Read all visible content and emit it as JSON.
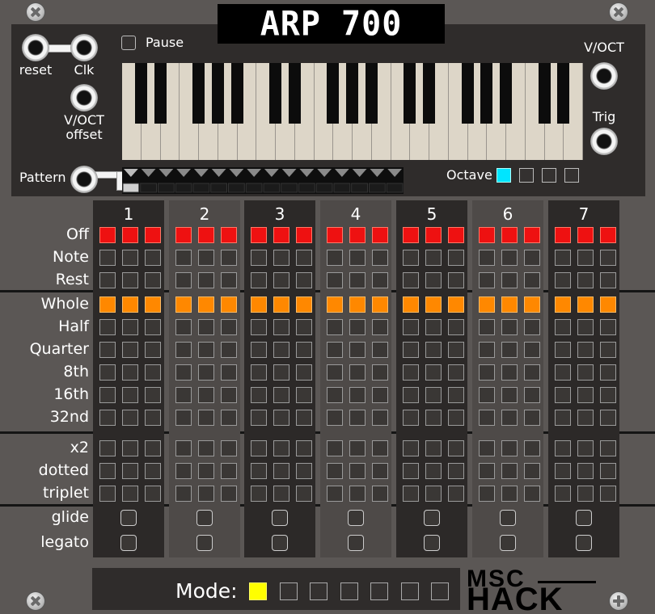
{
  "title": "ARP 700",
  "pause_label": "Pause",
  "jacks": {
    "reset": "reset",
    "clk": "Clk",
    "voct_offset_line1": "V/OCT",
    "voct_offset_line2": "offset",
    "voct_out": "V/OCT",
    "trig_out": "Trig",
    "pattern": "Pattern"
  },
  "octave": {
    "label": "Octave",
    "options": 4,
    "active_index": 0,
    "active_color": "#00e5ff"
  },
  "columns": [
    "1",
    "2",
    "3",
    "4",
    "5",
    "6",
    "7"
  ],
  "row_groups": {
    "group1": [
      "Off",
      "Note",
      "Rest"
    ],
    "group2": [
      "Whole",
      "Half",
      "Quarter",
      "8th",
      "16th",
      "32nd"
    ],
    "group3": [
      "x2",
      "dotted",
      "triplet"
    ],
    "group4": [
      "glide",
      "legato"
    ]
  },
  "active_rows": {
    "Off": "red",
    "Whole": "orange"
  },
  "colors": {
    "red": "#ee1111",
    "orange": "#ff8800",
    "mode_active": "#ffff00",
    "octave_active": "#00e5ff"
  },
  "mode": {
    "label": "Mode:",
    "options": 7,
    "active_index": 0
  },
  "logo": {
    "line1": "MSC",
    "line2": "HACK"
  },
  "icons": [
    "screw-icon",
    "jack-icon"
  ]
}
